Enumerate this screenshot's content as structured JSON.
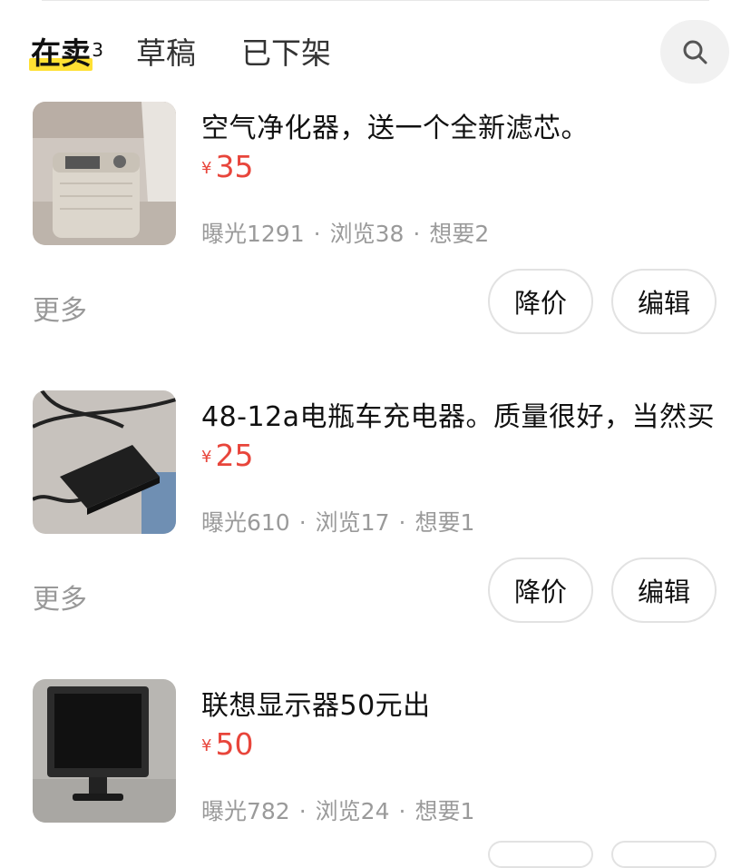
{
  "tabs": [
    {
      "label": "在卖",
      "count": "3"
    },
    {
      "label": "草稿"
    },
    {
      "label": "已下架"
    }
  ],
  "search": {
    "icon": "search-icon"
  },
  "items": [
    {
      "title": "空气净化器，送一个全新滤芯。",
      "currency": "¥",
      "price": "35",
      "stats": {
        "exposure": "曝光1291",
        "views": "浏览38",
        "wants": "想要2"
      },
      "more": "更多",
      "reduce_label": "降价",
      "edit_label": "编辑"
    },
    {
      "title": "48-12a电瓶车充电器。质量很好，当然买",
      "currency": "¥",
      "price": "25",
      "stats": {
        "exposure": "曝光610",
        "views": "浏览17",
        "wants": "想要1"
      },
      "more": "更多",
      "reduce_label": "降价",
      "edit_label": "编辑"
    },
    {
      "title": "联想显示器50元出",
      "currency": "¥",
      "price": "50",
      "stats": {
        "exposure": "曝光782",
        "views": "浏览24",
        "wants": "想要1"
      }
    }
  ],
  "colors": {
    "accent_price": "#e8453b",
    "tab_highlight": "#ffe033"
  }
}
